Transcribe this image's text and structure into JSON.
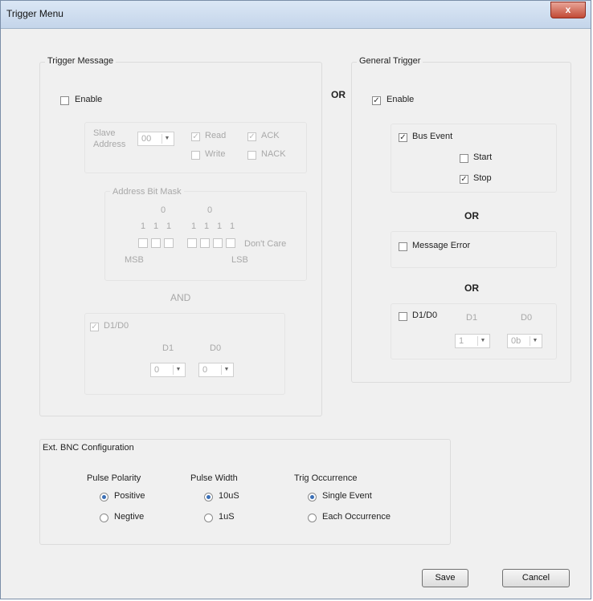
{
  "window": {
    "title": "Trigger Menu",
    "close_glyph": "x"
  },
  "trigger_message": {
    "label": "Trigger Message",
    "enable_label": "Enable",
    "enable_checked": false,
    "slave_address_label": "Slave Address",
    "slave_address_value": "00",
    "read_label": "Read",
    "read_checked": true,
    "write_label": "Write",
    "write_checked": false,
    "ack_label": "ACK",
    "ack_checked": true,
    "nack_label": "NACK",
    "nack_checked": false,
    "mask": {
      "label": "Address Bit Mask",
      "group1_zero": "0",
      "group2_zero": "0",
      "ones": [
        "1",
        "1",
        "1",
        "1",
        "1",
        "1",
        "1"
      ],
      "dont_care_label": "Don't Care",
      "msb_label": "MSB",
      "lsb_label": "LSB"
    },
    "and_label": "AND",
    "d1d0": {
      "label": "D1/D0",
      "checked": true,
      "d1_label": "D1",
      "d0_label": "D0",
      "d1_value": "0",
      "d0_value": "0"
    }
  },
  "or_label": "OR",
  "general_trigger": {
    "label": "General Trigger",
    "enable_label": "Enable",
    "enable_checked": true,
    "bus_event_label": "Bus Event",
    "bus_event_checked": true,
    "start_label": "Start",
    "start_checked": false,
    "stop_label": "Stop",
    "stop_checked": true,
    "or1": "OR",
    "message_error_label": "Message Error",
    "message_error_checked": false,
    "or2": "OR",
    "d1d0_label": "D1/D0",
    "d1d0_checked": false,
    "d1_label": "D1",
    "d0_label": "D0",
    "d1_value": "1",
    "d0_value": "0b"
  },
  "bnc": {
    "label": "Ext. BNC Configuration",
    "pulse_polarity": {
      "label": "Pulse Polarity",
      "options": [
        "Positive",
        "Negtive"
      ],
      "selected": 0
    },
    "pulse_width": {
      "label": "Pulse Width",
      "options": [
        "10uS",
        "1uS"
      ],
      "selected": 0
    },
    "trig_occurrence": {
      "label": "Trig Occurrence",
      "options": [
        "Single Event",
        "Each Occurrence"
      ],
      "selected": 0
    }
  },
  "buttons": {
    "save": "Save",
    "cancel": "Cancel"
  },
  "icons": {
    "checkmark": "check-glyph",
    "dropdown": "chevron-down-icon"
  }
}
